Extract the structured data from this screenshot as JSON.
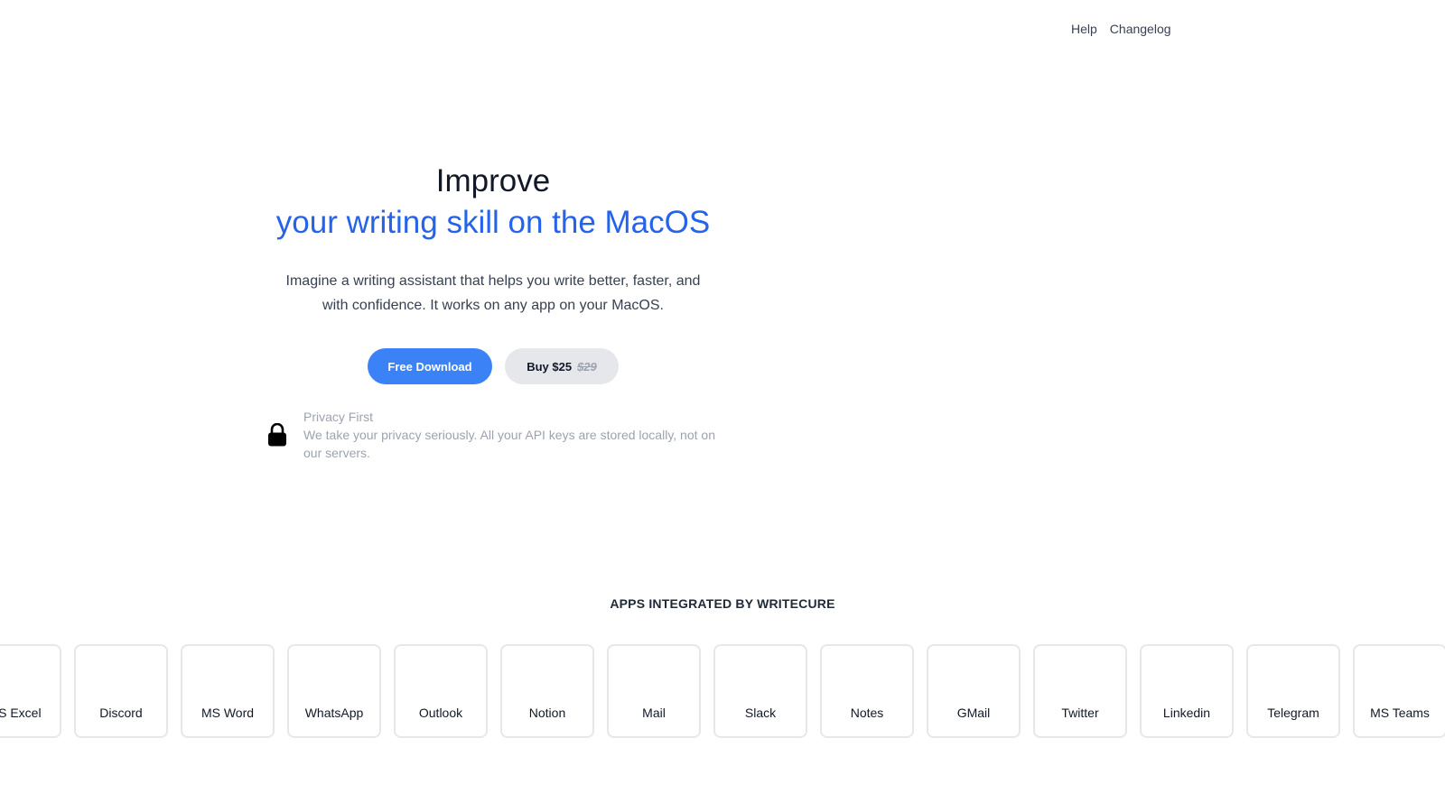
{
  "nav": {
    "help": "Help",
    "changelog": "Changelog"
  },
  "hero": {
    "title": "Improve",
    "subtitle": "your writing skill on the MacOS",
    "description": "Imagine a writing assistant that helps you write better, faster, and with confidence. It works on any app on your MacOS.",
    "download_label": "Free Download",
    "buy_label": "Buy $25",
    "old_price": "$29"
  },
  "privacy": {
    "icon": "lock-icon",
    "title": "Privacy First",
    "text": "We take your privacy seriously. All your API keys are stored locally, not on our servers."
  },
  "apps": {
    "heading": "APPS INTEGRATED BY WRITECURE",
    "items": [
      {
        "label": "MS Excel"
      },
      {
        "label": "Discord"
      },
      {
        "label": "MS Word"
      },
      {
        "label": "WhatsApp"
      },
      {
        "label": "Outlook"
      },
      {
        "label": "Notion"
      },
      {
        "label": "Mail"
      },
      {
        "label": "Slack"
      },
      {
        "label": "Notes"
      },
      {
        "label": "GMail"
      },
      {
        "label": "Twitter"
      },
      {
        "label": "Linkedin"
      },
      {
        "label": "Telegram"
      },
      {
        "label": "MS Teams"
      }
    ]
  },
  "colors": {
    "accent": "#2563eb",
    "button_primary": "#3b82f6",
    "button_secondary": "#e5e7eb",
    "muted_text": "#9ca3af"
  }
}
